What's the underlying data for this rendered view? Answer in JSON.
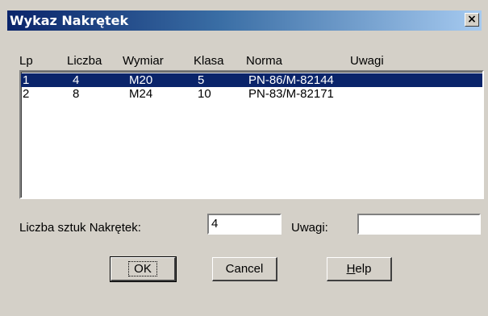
{
  "window": {
    "title": "Wykaz Nakrętek",
    "close_glyph": "×"
  },
  "list": {
    "columns": [
      "Lp",
      "Liczba",
      "Wymiar",
      "Klasa",
      "Norma",
      "Uwagi"
    ],
    "rows": [
      {
        "lp": "1",
        "liczba": "4",
        "wymiar": "M20",
        "klasa": "5",
        "norma": "PN-86/M-82144",
        "uwagi": "",
        "selected": true
      },
      {
        "lp": "2",
        "liczba": "8",
        "wymiar": "M24",
        "klasa": "10",
        "norma": "PN-83/M-82171",
        "uwagi": "",
        "selected": false
      }
    ]
  },
  "form": {
    "count_label": "Liczba sztuk Nakrętek:",
    "count_value": "4",
    "notes_label": "Uwagi:",
    "notes_value": ""
  },
  "buttons": {
    "ok": "OK",
    "cancel": "Cancel",
    "help": "Help"
  },
  "colors": {
    "face": "#d4d0c8",
    "selection": "#0a246a",
    "title_start": "#0a246a",
    "title_end": "#a6caf0"
  }
}
